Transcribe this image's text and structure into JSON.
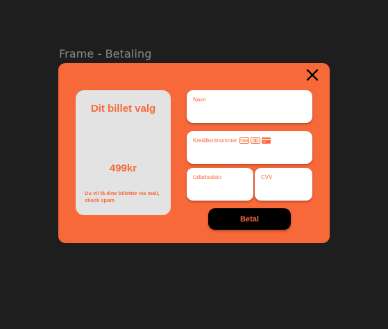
{
  "frame": {
    "label": "Frame - Betaling"
  },
  "summary": {
    "title": "Dit billet valg",
    "price": "499kr",
    "note": "Du vil få dine billetter via mail, check spam"
  },
  "form": {
    "name_label": "Navn",
    "card_label": "Kreditkortnummer",
    "card_icons": [
      "visa-icon",
      "mastercard-icon",
      "credit-card-icon"
    ],
    "expiry_label": "Udløbsdato",
    "cvv_label": "CVV",
    "submit_label": "Betal"
  },
  "colors": {
    "background": "#1e1e1e",
    "accent": "#f8693a",
    "card": "#e3e3e3",
    "button": "#000000"
  }
}
